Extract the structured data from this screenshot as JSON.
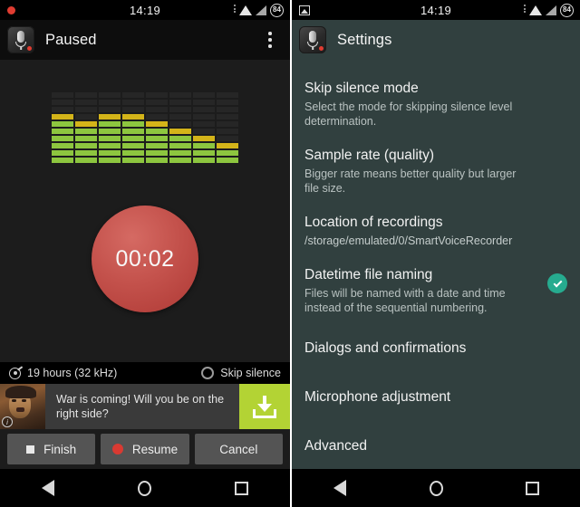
{
  "left": {
    "statusbar": {
      "clock": "14:19",
      "battery_level": "84",
      "rec_indicator": "recording-dot"
    },
    "appbar": {
      "title": "Paused"
    },
    "equalizer": {
      "columns": 8,
      "rows": 10,
      "levels": [
        7,
        6,
        7,
        7,
        6,
        5,
        4,
        3
      ],
      "bar_color": "#8dc63f",
      "peak_color": "#d4b419",
      "empty_color": "#262626"
    },
    "timer": {
      "value": "00:02",
      "circle_color": "#c4524c"
    },
    "info": {
      "capacity": "19 hours (32 kHz)",
      "skip_silence_label": "Skip silence",
      "skip_silence_checked": false
    },
    "ad": {
      "text": "War is coming! Will you be on the right side?",
      "info_badge": "i",
      "cta_icon": "download-icon",
      "cta_color": "#b3d334"
    },
    "buttons": {
      "finish": "Finish",
      "resume": "Resume",
      "cancel": "Cancel"
    }
  },
  "right": {
    "statusbar": {
      "clock": "14:19",
      "battery_level": "84",
      "left_icon": "image-icon"
    },
    "appbar": {
      "title": "Settings",
      "bg_color": "#31403f"
    },
    "settings": [
      {
        "title": "Skip silence mode",
        "sub": "Select the mode for skipping silence level determination.",
        "checked": false
      },
      {
        "title": "Sample rate (quality)",
        "sub": "Bigger rate means better quality but larger file size.",
        "checked": false
      },
      {
        "title": "Location of recordings",
        "sub": "/storage/emulated/0/SmartVoiceRecorder",
        "checked": false
      },
      {
        "title": "Datetime file naming",
        "sub": "Files will be named with a date and time instead of the sequential numbering.",
        "checked": true
      },
      {
        "title": "Dialogs and confirmations",
        "sub": "",
        "checked": false
      },
      {
        "title": "Microphone adjustment",
        "sub": "",
        "checked": false
      },
      {
        "title": "Advanced",
        "sub": "",
        "checked": false
      }
    ]
  },
  "navbar": {
    "back": "back-icon",
    "home": "home-icon",
    "recents": "recents-icon"
  }
}
